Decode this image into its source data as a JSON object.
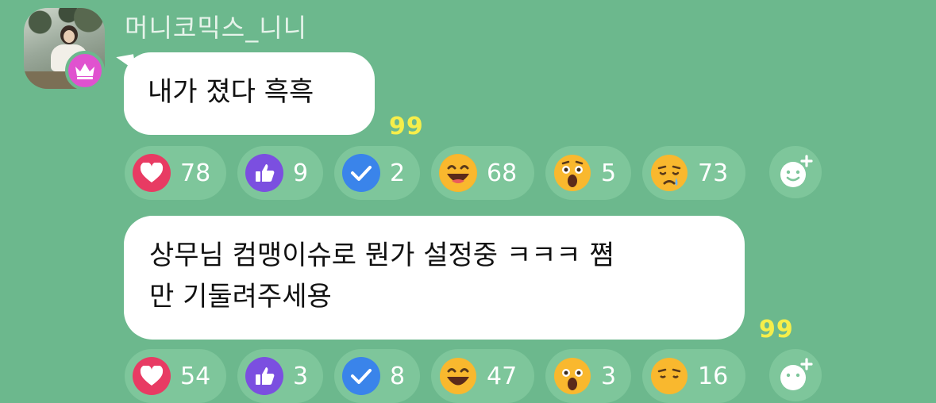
{
  "sender": {
    "name": "머니코믹스_니니"
  },
  "messages": [
    {
      "text": "내가 졌다 흑흑",
      "read": "99"
    },
    {
      "text_line1": "상무님 컴맹이슈로 뭔가 설정중 ㅋㅋㅋ 쪔",
      "text_line2": "만 기둘려주세용",
      "read": "99"
    }
  ],
  "reactions_1": [
    {
      "icon": "heart-icon",
      "count": "78",
      "color": "#e83b63"
    },
    {
      "icon": "thumbs-up-icon",
      "count": "9",
      "color": "#7b4fe0"
    },
    {
      "icon": "check-icon",
      "count": "2",
      "color": "#3a84ea"
    },
    {
      "icon": "laughing-face-icon",
      "count": "68",
      "color": "#f7b52b"
    },
    {
      "icon": "surprised-face-icon",
      "count": "5",
      "color": "#f7b52b"
    },
    {
      "icon": "sad-face-icon",
      "count": "73",
      "color": "#f7b52b"
    }
  ],
  "reactions_2": [
    {
      "icon": "heart-icon",
      "count": "54"
    },
    {
      "icon": "thumbs-up-icon",
      "count": "3"
    },
    {
      "icon": "check-icon",
      "count": "8"
    },
    {
      "icon": "laughing-face-icon",
      "count": "47"
    },
    {
      "icon": "surprised-face-icon",
      "count": "3"
    },
    {
      "icon": "sad-face-icon",
      "count": "16"
    }
  ],
  "icons": {
    "badge": "crown-icon",
    "add": "add-reaction-icon"
  },
  "colors": {
    "background": "#6cb88d",
    "badge": "#e052cf",
    "read_count": "#f6ee4a"
  }
}
